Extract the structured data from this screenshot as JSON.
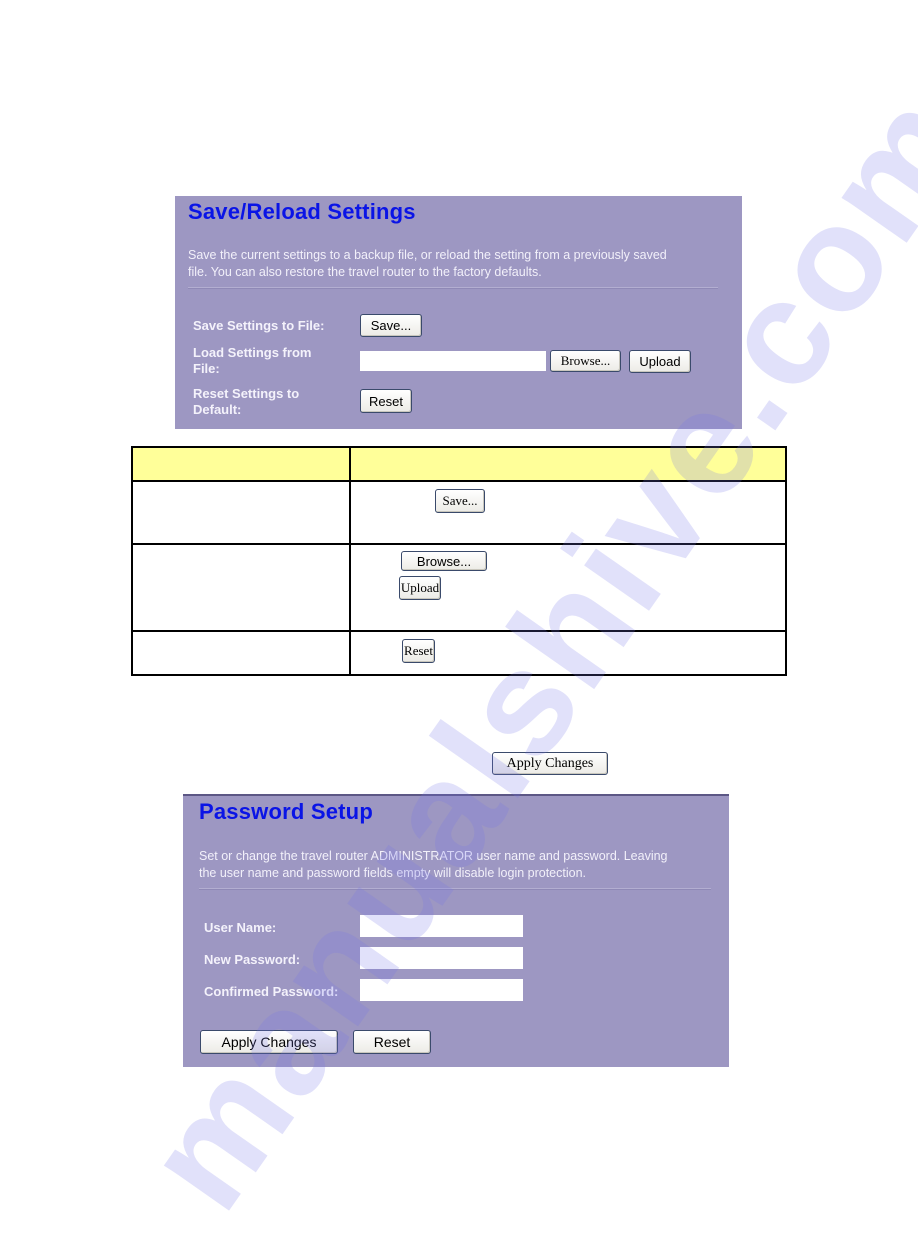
{
  "save_reload_panel": {
    "title": "Save/Reload Settings",
    "description_line1": "Save the current settings to a backup file, or reload the setting from a previously saved",
    "description_line2": "file. You can also restore the travel router to the factory defaults.",
    "rows": [
      {
        "label_line1": "Save Settings to File:",
        "label_line2": "",
        "button": "Save..."
      },
      {
        "label_line1": "Load Settings from",
        "label_line2": "File:",
        "file_value": "",
        "browse_button": "Browse...",
        "upload_button": "Upload"
      },
      {
        "label_line1": "Reset Settings to",
        "label_line2": "Default:",
        "button": "Reset"
      }
    ]
  },
  "description_table": {
    "headers": [
      "",
      ""
    ],
    "rows": [
      {
        "item": "",
        "buttons": [
          "Save..."
        ]
      },
      {
        "item": "",
        "buttons": [
          "Browse...",
          "Upload"
        ]
      },
      {
        "item": "",
        "buttons": [
          "Reset"
        ]
      }
    ]
  },
  "inline_apply_button": "Apply Changes",
  "password_panel": {
    "title": "Password Setup",
    "description_line1": "Set or change the travel router ADMINISTRATOR user name and password. Leaving",
    "description_line2": "the user name and password fields empty will disable login protection.",
    "fields": [
      {
        "label": "User Name:",
        "value": ""
      },
      {
        "label": "New Password:",
        "value": ""
      },
      {
        "label": "Confirmed Password:",
        "value": ""
      }
    ],
    "apply_button": "Apply Changes",
    "reset_button": "Reset"
  },
  "watermark": "manualshive.com",
  "colors": {
    "panel_bg": "#9d97c2",
    "title_blue": "#0a14e6",
    "table_header_bg": "#ffff99"
  }
}
